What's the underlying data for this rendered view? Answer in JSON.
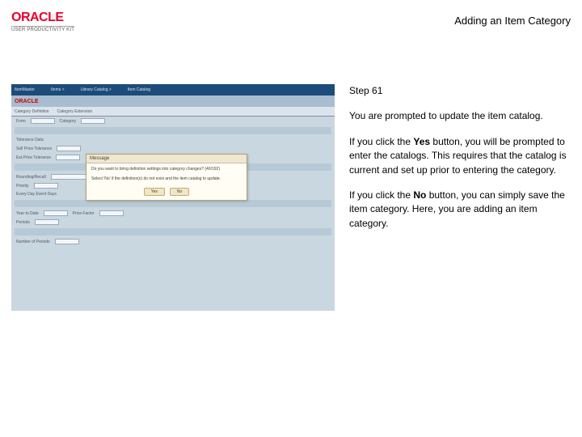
{
  "header": {
    "logo_text": "ORACLE",
    "logo_sub": "USER PRODUCTIVITY KIT",
    "page_title": "Adding an Item Category"
  },
  "screenshot": {
    "topbar": [
      "ItemMaster",
      "Items >",
      "Library Catalog >",
      "Item Catalog"
    ],
    "brand": "ORACLE",
    "tabs": [
      "Category Definition",
      "Category Extension"
    ],
    "dialog_title": "Message",
    "dialog_line1": "Do you want to bring definition settings into category changes? (40/192)",
    "dialog_line2": "Select 'No' if the definition(s) do not exist and the item catalog to update.",
    "yes_label": "Yes",
    "no_label": "No"
  },
  "step": {
    "label": "Step 61",
    "p1": "You are prompted to update the item catalog.",
    "p2_pre": "If you click the ",
    "p2_bold": "Yes",
    "p2_post": " button, you will be prompted to enter the catalogs. This requires that the catalog is current and set up prior to entering the category.",
    "p3_pre": "If you click the ",
    "p3_bold": "No",
    "p3_post": " button, you can simply save the item category. Here, you are adding an item category."
  }
}
